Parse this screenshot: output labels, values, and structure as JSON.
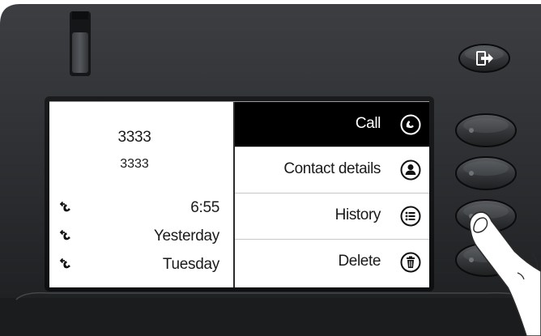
{
  "contact": {
    "name": "3333",
    "number": "3333"
  },
  "history": [
    {
      "type": "missed-call",
      "time": "6:55"
    },
    {
      "type": "missed-call",
      "time": "Yesterday"
    },
    {
      "type": "missed-call",
      "time": "Tuesday"
    }
  ],
  "menu": [
    {
      "label": "Call",
      "icon": "phone-icon",
      "selected": true
    },
    {
      "label": "Contact details",
      "icon": "contact-icon",
      "selected": false
    },
    {
      "label": "History",
      "icon": "list-icon",
      "selected": false
    },
    {
      "label": "Delete",
      "icon": "trash-icon",
      "selected": false
    }
  ],
  "hardware_keys": {
    "escape_icon": "exit-icon",
    "softkey_count": 4,
    "pressed_softkey": 3
  },
  "colors": {
    "body": "#2c2e31",
    "screen_background": "#ffffff",
    "selected_background": "#000000",
    "selected_text": "#ffffff",
    "text": "#1a1a1a"
  }
}
